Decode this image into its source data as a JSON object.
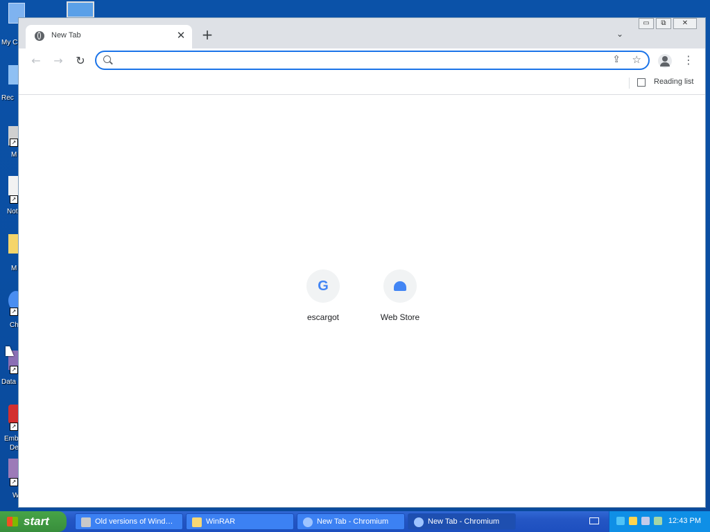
{
  "desktop": {
    "icons": [
      {
        "label": "My C",
        "name": "my-computer"
      },
      {
        "label": "Rec",
        "name": "recycle-bin"
      },
      {
        "label": "M",
        "name": "shortcut-m"
      },
      {
        "label": "Not",
        "name": "notepad"
      },
      {
        "label": "M",
        "name": "folder-m"
      },
      {
        "label": "Ch",
        "name": "chromium"
      },
      {
        "label": "Data",
        "name": "data"
      },
      {
        "label": "Emb",
        "name": "emb"
      },
      {
        "label": "De",
        "name": "de"
      },
      {
        "label": "W",
        "name": "winrar"
      }
    ]
  },
  "browser": {
    "tab": {
      "title": "New Tab",
      "close": "✕"
    },
    "new_tab": "+",
    "tab_search": "⌄",
    "window_controls": {
      "minimize": "▭",
      "maximize": "⧉",
      "close": "✕"
    },
    "nav": {
      "back": "←",
      "forward": "→",
      "reload": "↻"
    },
    "omnibox": {
      "value": "",
      "placeholder": ""
    },
    "icons": {
      "share": "⇪",
      "bookmark": "☆",
      "menu": "⋮"
    },
    "reading_list": "Reading list",
    "shortcuts": [
      {
        "label": "escargot",
        "icon": "G"
      },
      {
        "label": "Web Store",
        "icon": ""
      }
    ]
  },
  "taskbar": {
    "start": "start",
    "tasks": [
      {
        "label": "Old versions of Wind…",
        "active": false
      },
      {
        "label": "WinRAR",
        "active": false
      },
      {
        "label": "New Tab - Chromium",
        "active": false
      },
      {
        "label": "New Tab - Chromium",
        "active": true
      }
    ],
    "clock": "12:43 PM"
  },
  "colors": {
    "desktop": "#0a4ea3",
    "accent": "#1a73e8",
    "taskbar": "#2456c4",
    "start": "#388e3c"
  }
}
